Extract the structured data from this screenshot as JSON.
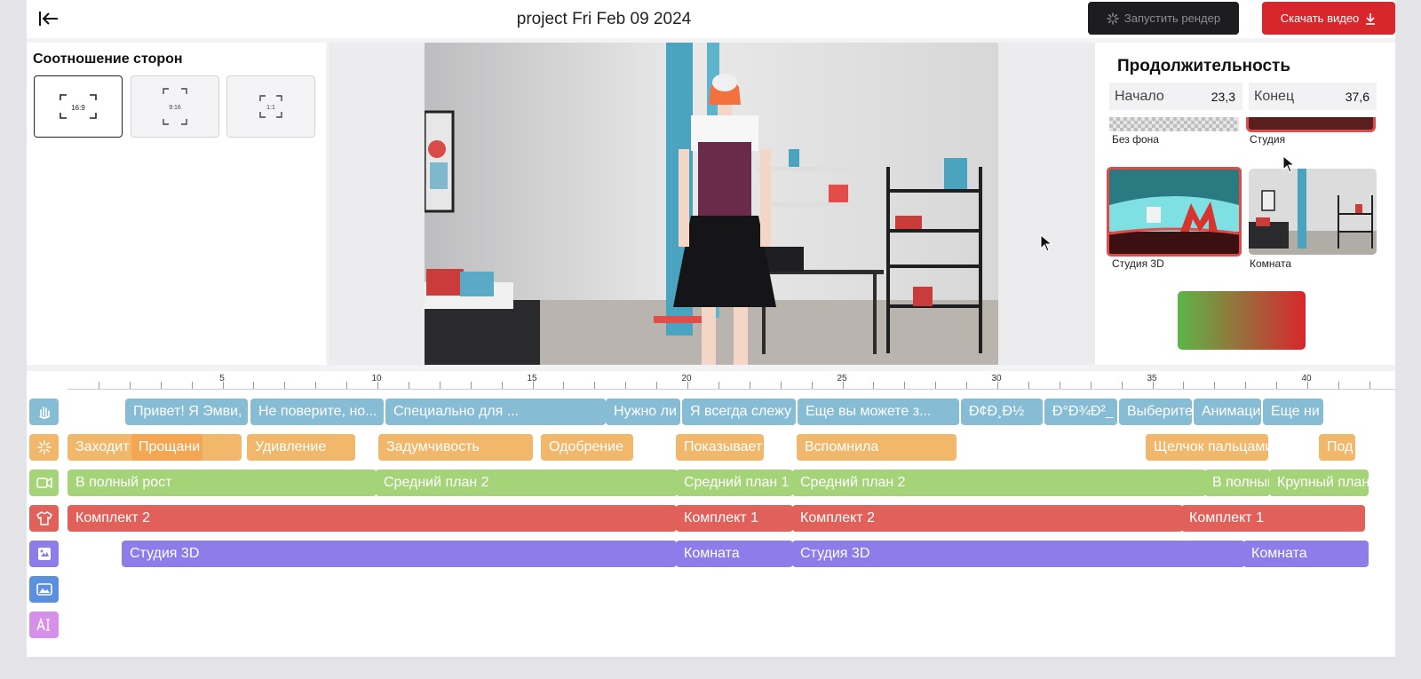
{
  "header": {
    "title": "project Fri Feb 09 2024",
    "render_label": "Запустить рендер",
    "download_label": "Скачать видео"
  },
  "aspect": {
    "title": "Соотношение сторон",
    "options": [
      "16:9",
      "9:16",
      "1:1"
    ],
    "selected": "16:9"
  },
  "duration": {
    "title": "Продолжительность",
    "start_label": "Начало",
    "start_value": "23,3",
    "end_label": "Конец",
    "end_value": "37,6"
  },
  "backgrounds": {
    "items": [
      {
        "label": "Без фона"
      },
      {
        "label": "Студия"
      },
      {
        "label": "Студия 3D",
        "selected": true
      },
      {
        "label": "Комната"
      }
    ]
  },
  "ruler": {
    "labels": [
      "5",
      "10",
      "15",
      "20",
      "25",
      "30",
      "35",
      "40"
    ]
  },
  "tracks": {
    "dialog": [
      {
        "label": "Привет! Я Эмви,"
      },
      {
        "label": "Не поверите, но..."
      },
      {
        "label": "Специально для ..."
      },
      {
        "label": "Нужно ли"
      },
      {
        "label": "Я всегда слежу"
      },
      {
        "label": "Еще вы можете з..."
      },
      {
        "label": "Ð¢Ð¸Ð½"
      },
      {
        "label": "Ð°Ð¾Ð²_"
      },
      {
        "label": "Выберите"
      },
      {
        "label": "Анимаци"
      },
      {
        "label": "Еще ни"
      }
    ],
    "gestures": [
      {
        "label": "Заходит"
      },
      {
        "label": "Прощани"
      },
      {
        "label": "Удивление"
      },
      {
        "label": "Задумчивость"
      },
      {
        "label": "Одобрение"
      },
      {
        "label": "Показывает"
      },
      {
        "label": "Вспомнила"
      },
      {
        "label": "Щелчок пальцами"
      },
      {
        "label": "Под"
      }
    ],
    "camera": [
      {
        "label": "В полный рост"
      },
      {
        "label": "Средний план 2"
      },
      {
        "label": "Средний план 1"
      },
      {
        "label": "Средний план 2"
      },
      {
        "label": "В полный"
      },
      {
        "label": "Крупный план"
      }
    ],
    "outfit": [
      {
        "label": "Комплект 2"
      },
      {
        "label": "Комплект 1"
      },
      {
        "label": "Комплект 2"
      },
      {
        "label": "Комплект 1"
      }
    ],
    "scene": [
      {
        "label": "Студия 3D"
      },
      {
        "label": "Комната"
      },
      {
        "label": "Студия 3D"
      },
      {
        "label": "Комната"
      }
    ]
  },
  "colors": {
    "accent": "#d8262d",
    "dialog": "#87bcd5",
    "gestures": "#f1b76a",
    "camera": "#a5d377",
    "outfit": "#e2605a",
    "scene": "#8d7ce9",
    "image_track": "#5b8fe0",
    "text_track": "#d690ea"
  },
  "icons": {
    "back": "arrow-left-icon",
    "render": "spinner-icon",
    "download": "download-icon",
    "dialog": "hand-wave-icon",
    "gestures": "sparkle-icon",
    "camera": "video-camera-icon",
    "outfit": "tshirt-icon",
    "scene": "scene-icon",
    "image": "image-icon",
    "text": "text-icon"
  }
}
